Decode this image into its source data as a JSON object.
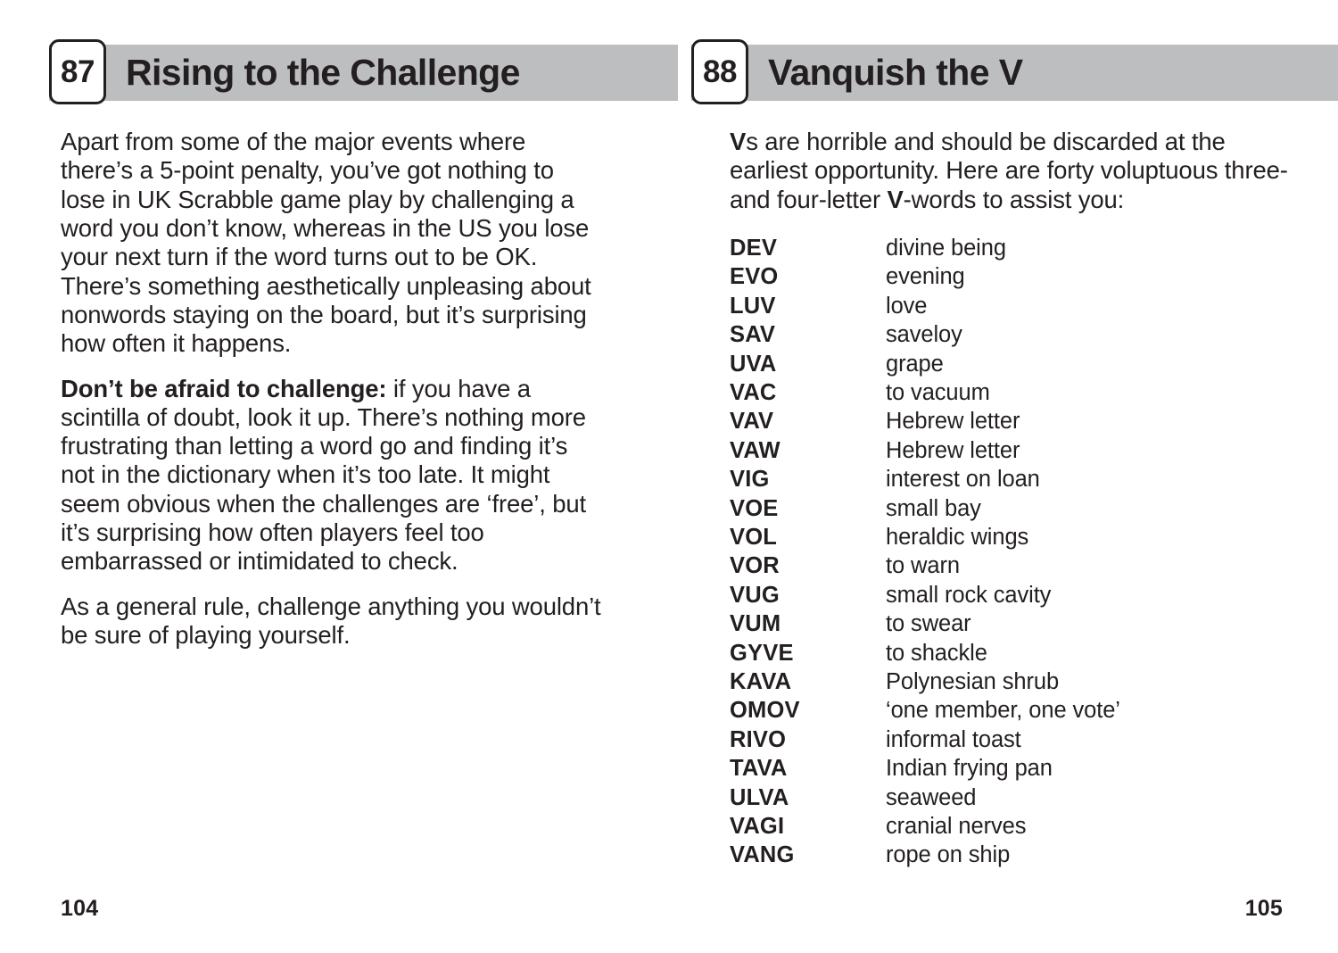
{
  "spread": {
    "left_page": {
      "tip_number": "87",
      "tip_title": "Rising to the Challenge",
      "paragraphs": [
        {
          "lead": "",
          "text": "Apart from some of the major events where there’s a 5-point penalty, you’ve got nothing to lose in UK Scrabble game play by challenging a word you don’t know, whereas in the US you lose your next turn if the word turns out to be OK. There’s something aesthetically unpleasing about nonwords staying on the board, but it’s surprising how often it happens."
        },
        {
          "lead": "Don’t be afraid to challenge:",
          "text": " if you have a scintilla of doubt, look it up. There’s nothing more frustrating than letting a word go and finding it’s not in the dictionary when it’s too late. It might seem obvious when the challenges are ‘free’, but it’s surprising how often players feel too embarrassed or intimidated to check."
        },
        {
          "lead": "",
          "text": "As a general rule, challenge anything you wouldn’t be sure of playing yourself."
        }
      ],
      "folio": "104"
    },
    "right_page": {
      "tip_number": "88",
      "tip_title": "Vanquish the V",
      "intro": {
        "lead": "V",
        "part1": "s are horrible and should be discarded at the earliest opportunity. Here are forty voluptuous three- and four-letter ",
        "bold2": "V",
        "part2": "-words to assist you:"
      },
      "word_list": [
        {
          "term": "DEV",
          "definition": "divine being"
        },
        {
          "term": "EVO",
          "definition": "evening"
        },
        {
          "term": "LUV",
          "definition": "love"
        },
        {
          "term": "SAV",
          "definition": "saveloy"
        },
        {
          "term": "UVA",
          "definition": "grape"
        },
        {
          "term": "VAC",
          "definition": "to vacuum"
        },
        {
          "term": "VAV",
          "definition": "Hebrew letter"
        },
        {
          "term": "VAW",
          "definition": "Hebrew letter"
        },
        {
          "term": "VIG",
          "definition": "interest on loan"
        },
        {
          "term": "VOE",
          "definition": "small bay"
        },
        {
          "term": "VOL",
          "definition": "heraldic wings"
        },
        {
          "term": "VOR",
          "definition": "to warn"
        },
        {
          "term": "VUG",
          "definition": "small rock cavity"
        },
        {
          "term": "VUM",
          "definition": "to swear"
        },
        {
          "term": "GYVE",
          "definition": "to shackle"
        },
        {
          "term": "KAVA",
          "definition": "Polynesian shrub"
        },
        {
          "term": "OMOV",
          "definition": "‘one member, one vote’"
        },
        {
          "term": "RIVO",
          "definition": "informal toast"
        },
        {
          "term": "TAVA",
          "definition": "Indian frying pan"
        },
        {
          "term": "ULVA",
          "definition": "seaweed"
        },
        {
          "term": "VAGI",
          "definition": "cranial nerves"
        },
        {
          "term": "VANG",
          "definition": "rope on ship"
        }
      ],
      "folio": "105"
    }
  },
  "colors": {
    "header_bar": "#bdbec0",
    "text": "#231f20",
    "page_background": "#ffffff"
  }
}
